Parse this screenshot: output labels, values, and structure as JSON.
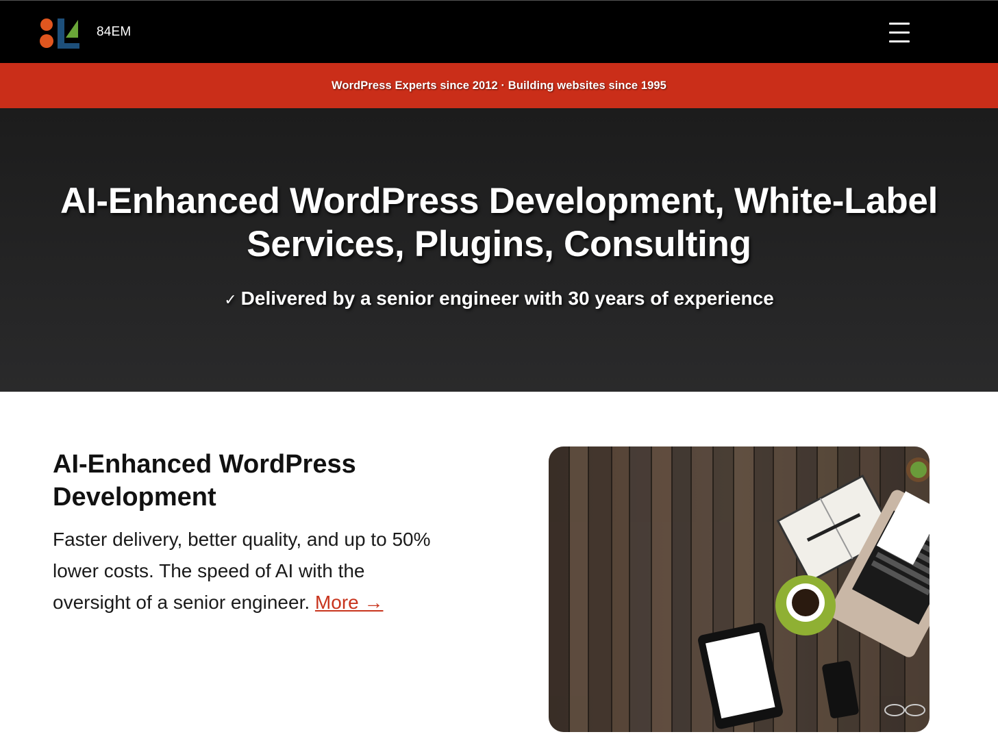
{
  "header": {
    "brand_name": "84EM",
    "logo_icon": "84em-logo",
    "menu_icon": "hamburger-menu-icon"
  },
  "announcement": {
    "text": "WordPress Experts since 2012 · Building websites since 1995"
  },
  "hero": {
    "title": "AI-Enhanced WordPress Development, White-Label Services, Plugins, Consulting",
    "subtitle_check": "✓",
    "subtitle": "Delivered by a senior engineer with 30 years of experience"
  },
  "feature": {
    "title": "AI-Enhanced WordPress Development",
    "body": "Faster delivery, better quality, and up to 50% lower costs. The speed of AI with the oversight of a senior engineer.",
    "more_label": "More →",
    "image_icon": "desk-workspace-photo"
  },
  "colors": {
    "topbar_bg": "#000000",
    "announce_bg": "#ca2e19",
    "hero_bg": "#1f1f1f",
    "link": "#c8341d",
    "logo_orange": "#e0561f",
    "logo_blue": "#1d4f7a",
    "logo_green": "#6aa638"
  }
}
